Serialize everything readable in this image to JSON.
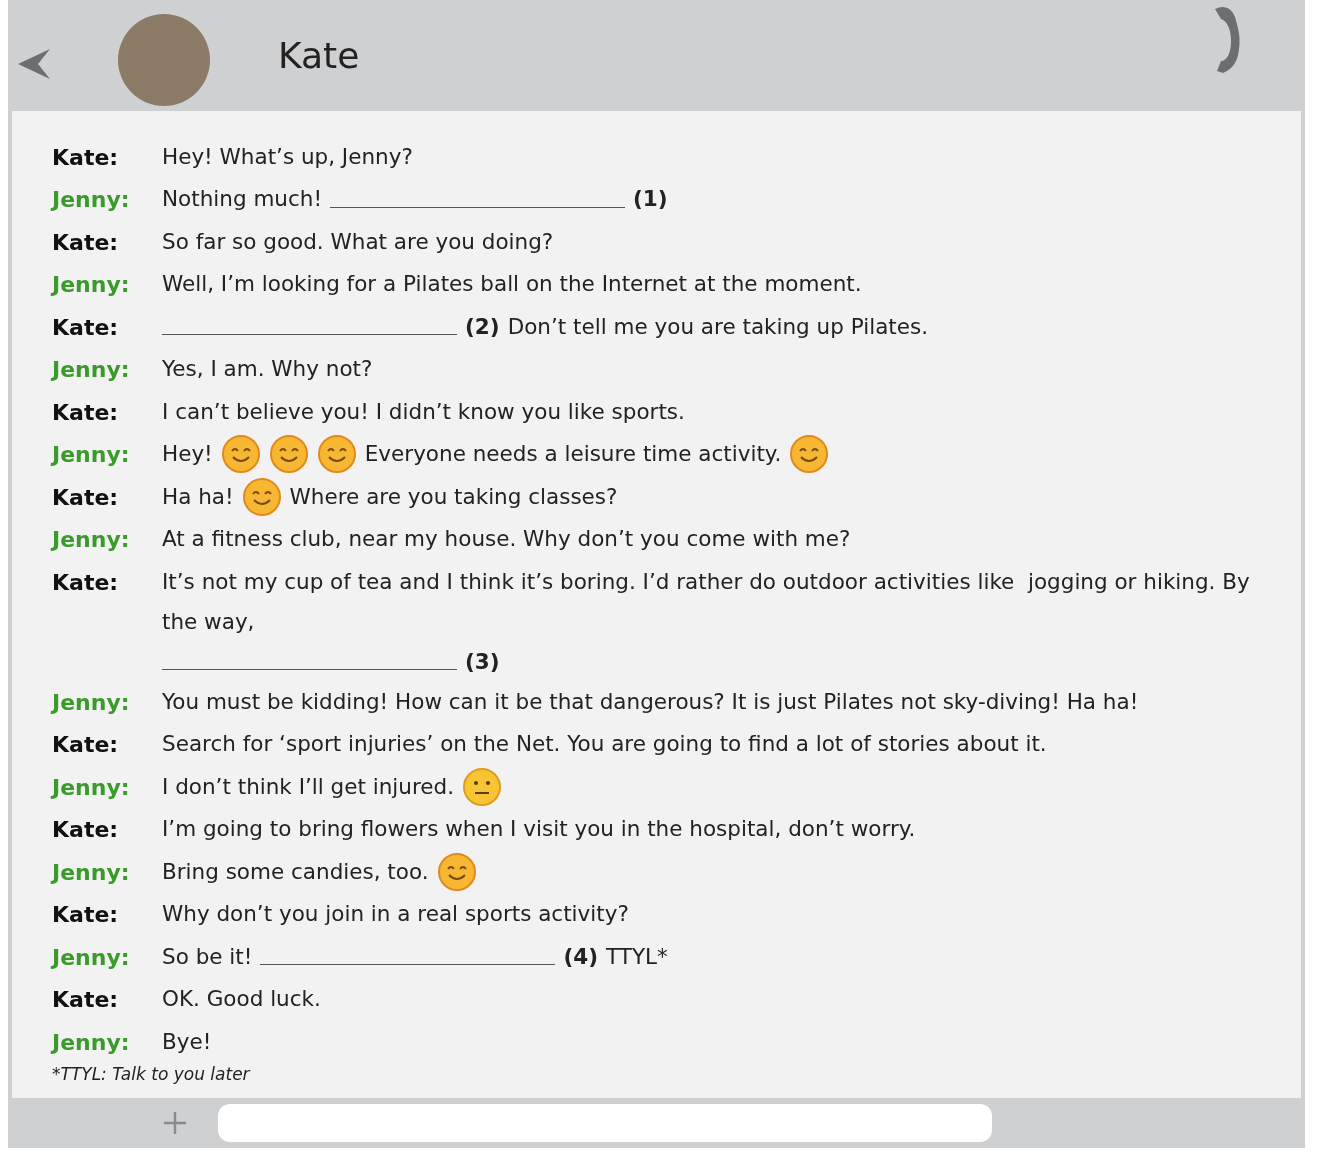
{
  "header": {
    "name": "Kate"
  },
  "messages": [
    {
      "speaker": "Kate:",
      "color": "#111111",
      "parts": [
        {
          "kind": "text",
          "text": "Hey! What’s up, Jenny?"
        }
      ]
    },
    {
      "speaker": "Jenny:",
      "color": "#3a9a2a",
      "parts": [
        {
          "kind": "text",
          "text": "Nothing much!"
        },
        {
          "kind": "blank"
        },
        {
          "kind": "number",
          "text": "(1)"
        }
      ]
    },
    {
      "speaker": "Kate:",
      "color": "#111111",
      "parts": [
        {
          "kind": "text",
          "text": "So far so good. What are you doing?"
        }
      ]
    },
    {
      "speaker": "Jenny:",
      "color": "#3a9a2a",
      "parts": [
        {
          "kind": "text",
          "text": "Well, I’m looking for a Pilates ball on the Internet at the moment."
        }
      ]
    },
    {
      "speaker": "Kate:",
      "color": "#111111",
      "parts": [
        {
          "kind": "blank"
        },
        {
          "kind": "number",
          "text": "(2)"
        },
        {
          "kind": "text",
          "text": "Don’t tell me you are taking up Pilates."
        }
      ]
    },
    {
      "speaker": "Jenny:",
      "color": "#3a9a2a",
      "parts": [
        {
          "kind": "text",
          "text": "Yes, I am. Why not?"
        }
      ]
    },
    {
      "speaker": "Kate:",
      "color": "#111111",
      "parts": [
        {
          "kind": "text",
          "text": "I can’t believe you! I didn’t know you like sports."
        }
      ]
    },
    {
      "speaker": "Jenny:",
      "color": "#3a9a2a",
      "parts": [
        {
          "kind": "text",
          "text": "Hey!"
        },
        {
          "kind": "smile"
        },
        {
          "kind": "smile"
        },
        {
          "kind": "smile"
        },
        {
          "kind": "text",
          "text": "Everyone needs a leisure time activity."
        },
        {
          "kind": "smile"
        }
      ]
    },
    {
      "speaker": "Kate:",
      "color": "#111111",
      "parts": [
        {
          "kind": "text",
          "text": "Ha ha!"
        },
        {
          "kind": "smile"
        },
        {
          "kind": "text",
          "text": "Where are you taking classes?"
        }
      ]
    },
    {
      "speaker": "Jenny:",
      "color": "#3a9a2a",
      "parts": [
        {
          "kind": "text",
          "text": "At a fitness club, near my house. Why don’t you come with me?"
        }
      ]
    },
    {
      "speaker": "Kate:",
      "color": "#111111",
      "parts": [
        {
          "kind": "text",
          "text": "It’s not my cup of tea and I think it’s boring. I’d rather do outdoor activities like  jogging or hiking. By the way,"
        },
        {
          "kind": "blank"
        },
        {
          "kind": "number",
          "text": "(3)"
        }
      ]
    },
    {
      "speaker": "Jenny:",
      "color": "#3a9a2a",
      "parts": [
        {
          "kind": "text",
          "text": "You must be kidding! How can it be that dangerous? It is just Pilates not sky-diving! Ha ha!"
        }
      ]
    },
    {
      "speaker": "Kate:",
      "color": "#111111",
      "parts": [
        {
          "kind": "text",
          "text": "Search for ‘sport injuries’ on the Net. You are going to find a lot of stories about it."
        }
      ]
    },
    {
      "speaker": "Jenny:",
      "color": "#3a9a2a",
      "parts": [
        {
          "kind": "text",
          "text": "I don’t think I’ll get injured."
        },
        {
          "kind": "neutral"
        }
      ]
    },
    {
      "speaker": "Kate:",
      "color": "#111111",
      "parts": [
        {
          "kind": "text",
          "text": "I’m going to bring flowers when I visit you in the hospital, don’t worry."
        }
      ]
    },
    {
      "speaker": "Jenny:",
      "color": "#3a9a2a",
      "parts": [
        {
          "kind": "text",
          "text": "Bring some candies, too."
        },
        {
          "kind": "smile"
        }
      ]
    },
    {
      "speaker": "Kate:",
      "color": "#111111",
      "parts": [
        {
          "kind": "text",
          "text": "Why don’t you join in a real sports activity?"
        }
      ]
    },
    {
      "speaker": "Jenny:",
      "color": "#3a9a2a",
      "parts": [
        {
          "kind": "text",
          "text": "So be it!"
        },
        {
          "kind": "blank"
        },
        {
          "kind": "number",
          "text": "(4)"
        },
        {
          "kind": "text",
          "text": "TTYL*"
        }
      ]
    },
    {
      "speaker": "Kate:",
      "color": "#111111",
      "parts": [
        {
          "kind": "text",
          "text": "OK. Good luck."
        }
      ]
    },
    {
      "speaker": "Jenny:",
      "color": "#3a9a2a",
      "parts": [
        {
          "kind": "text",
          "text": "Bye!"
        }
      ]
    }
  ],
  "footnote": "*TTYL: Talk to you later"
}
